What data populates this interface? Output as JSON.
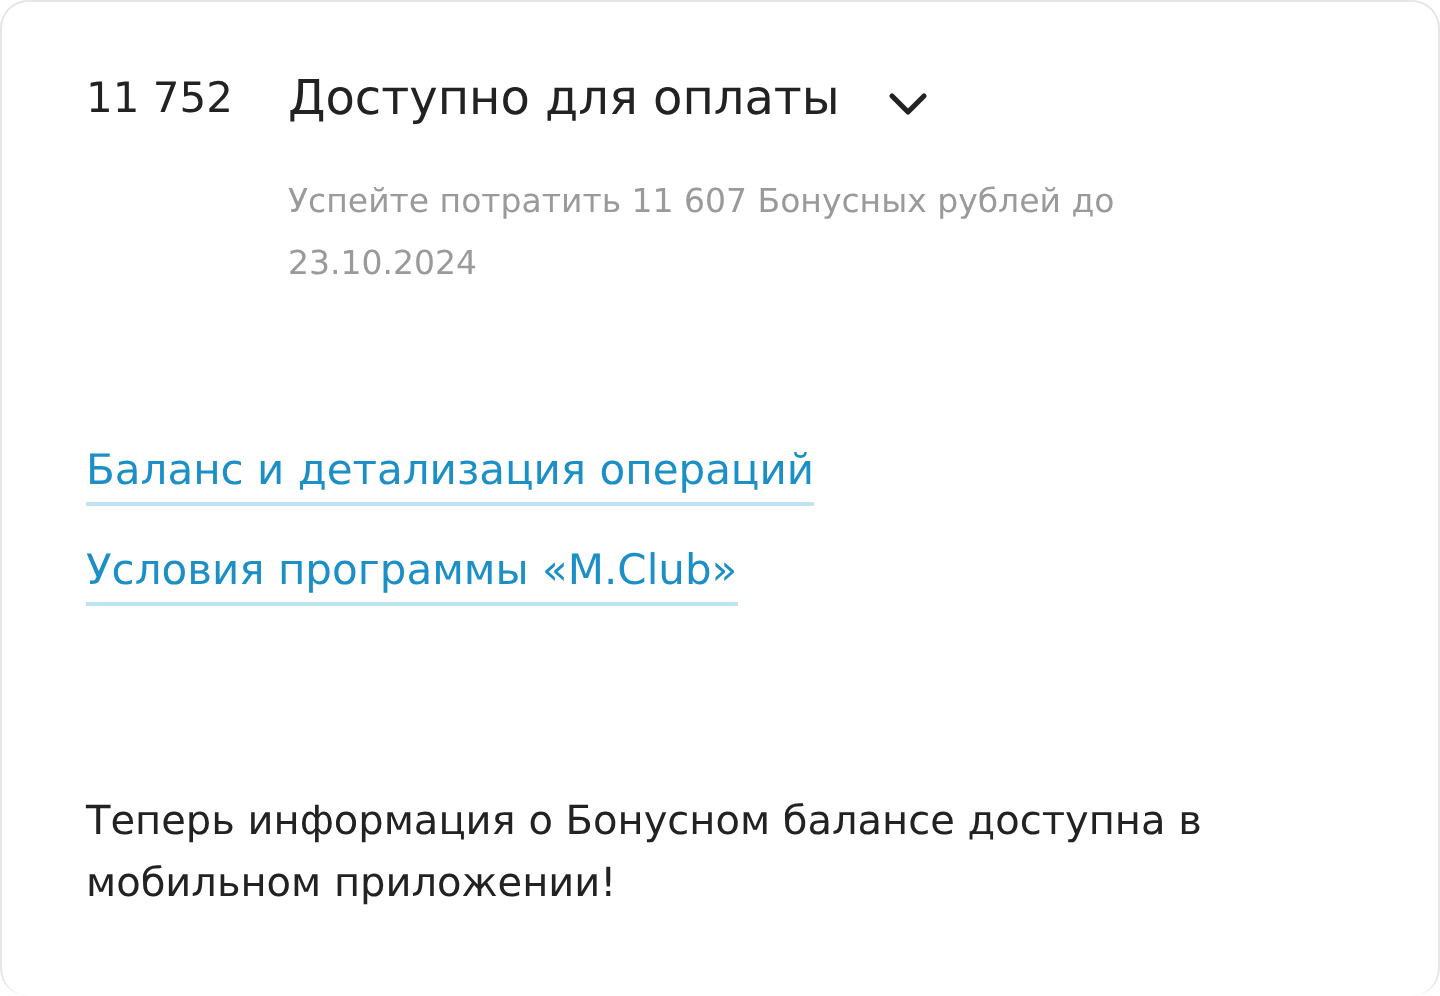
{
  "balance": {
    "amount": "11 752",
    "title": "Доступно для оплаты",
    "note": "Успейте потратить 11 607 Бонусных рублей до 23.10.2024"
  },
  "links": [
    "Баланс и детализация операций",
    "Условия программы «M.Club»"
  ],
  "message": "Теперь информация о Бонусном балансе доступна в мобильном приложении!"
}
